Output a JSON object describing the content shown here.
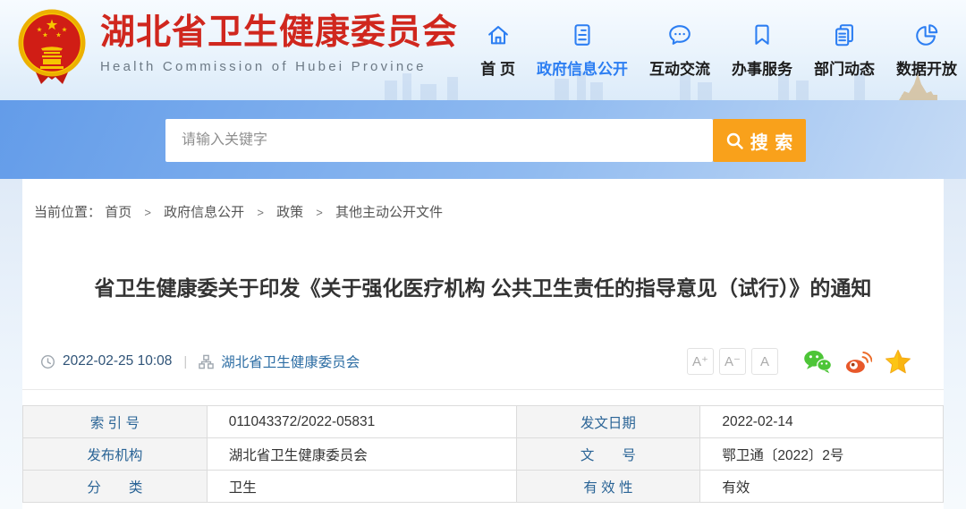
{
  "header": {
    "site_title": "湖北省卫生健康委员会",
    "site_subtitle": "Health Commission of Hubei Province",
    "nav": [
      {
        "label": "首 页",
        "icon": "home-icon"
      },
      {
        "label": "政府信息公开",
        "icon": "document-icon"
      },
      {
        "label": "互动交流",
        "icon": "chat-bubble-icon"
      },
      {
        "label": "办事服务",
        "icon": "bookmark-icon"
      },
      {
        "label": "部门动态",
        "icon": "documents-icon"
      },
      {
        "label": "数据开放",
        "icon": "pie-chart-icon"
      }
    ],
    "active_nav": "政府信息公开"
  },
  "search": {
    "placeholder": "请输入关键字",
    "button_label": "搜 索"
  },
  "breadcrumb": {
    "prefix": "当前位置：",
    "separator": ">",
    "items": [
      "首页",
      "政府信息公开",
      "政策",
      "其他主动公开文件"
    ]
  },
  "article": {
    "title": "省卫生健康委关于印发《关于强化医疗机构 公共卫生责任的指导意见（试行）》的通知",
    "publish_time": "2022-02-25 10:08",
    "meta_separator": "|",
    "source": "湖北省卫生健康委员会",
    "font_size_buttons": [
      "A⁺",
      "A⁻",
      "A"
    ],
    "share_icons": [
      "wechat-icon",
      "weibo-icon",
      "qzone-star-icon"
    ]
  },
  "info_table": {
    "rows": [
      {
        "c0": "索 引 号",
        "c1": "011043372/2022-05831",
        "c2": "发文日期",
        "c3": "2022-02-14"
      },
      {
        "c0": "发布机构",
        "c1": "湖北省卫生健康委员会",
        "c2": "文　　号",
        "c3": "鄂卫通〔2022〕2号"
      },
      {
        "c0": "分　　类",
        "c1": "卫生",
        "c2": "有 效 性",
        "c3": "有效"
      }
    ]
  },
  "colors": {
    "brand-red": "#d0271e",
    "nav-blue": "#2c7ef2",
    "search-orange": "#f9a11b",
    "link-blue": "#2b6ca3",
    "time-blue": "#2f5377",
    "table-label-blue": "#2a6496",
    "wechat-green": "#4dc537",
    "weibo-orange": "#e8582a",
    "qzone-gold": "#fcc514"
  }
}
